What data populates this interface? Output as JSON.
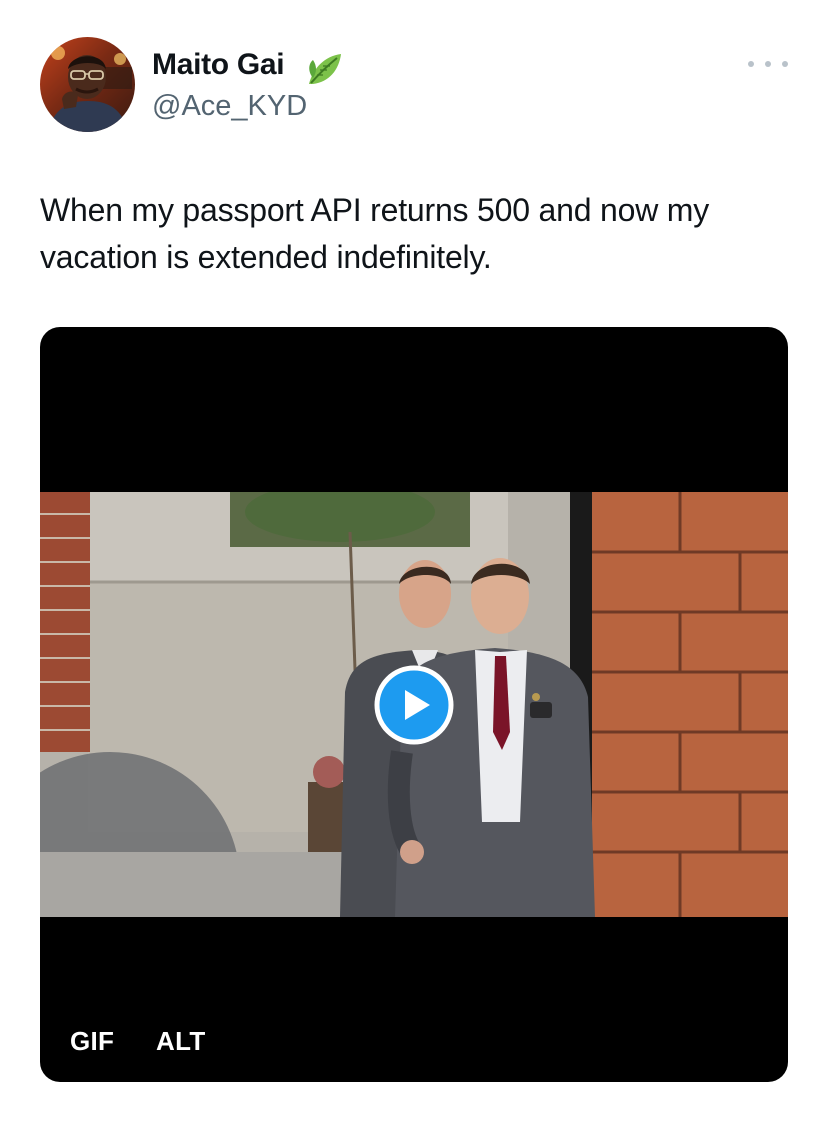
{
  "author": {
    "display_name": "Maito Gai",
    "handle": "@Ace_KYD",
    "badge_icon": "leaf-icon"
  },
  "tweet": {
    "text": "When my passport API returns 500 and now my vacation is extended indefinitely."
  },
  "media": {
    "type_badge": "GIF",
    "alt_badge": "ALT",
    "play_icon": "play-icon",
    "accent_color": "#1d9bf0"
  },
  "menu": {
    "icon": "more-icon"
  },
  "colors": {
    "text": "#0f1419",
    "secondary": "#536471",
    "accent": "#1d9bf0"
  }
}
